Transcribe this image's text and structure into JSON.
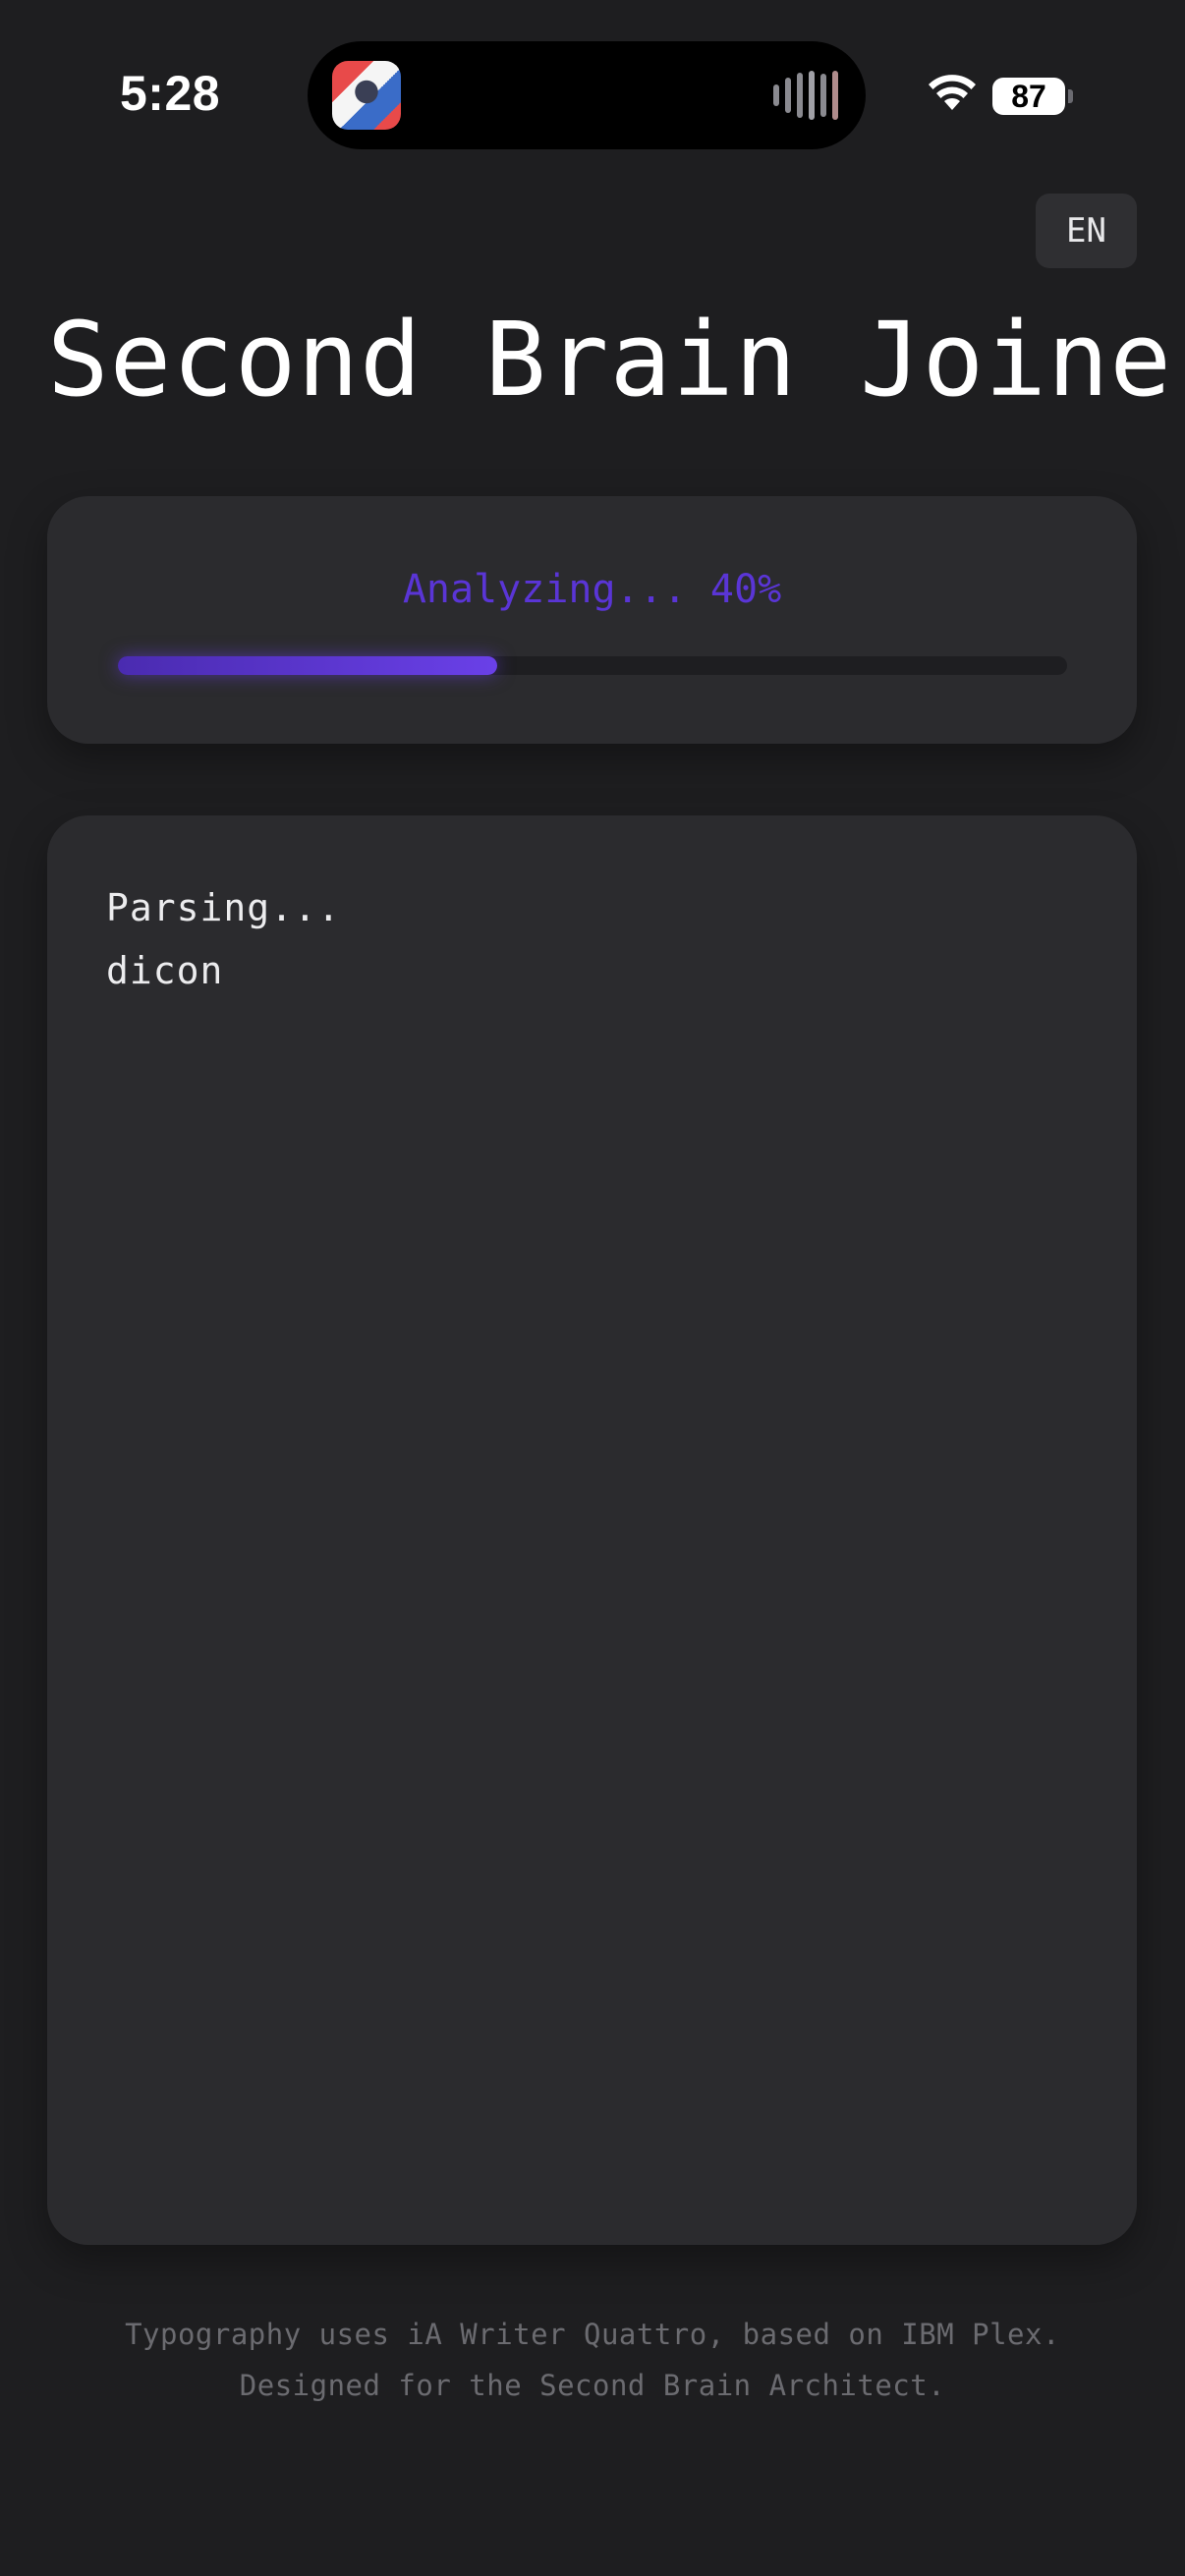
{
  "status_bar": {
    "time": "5:28",
    "battery": "87",
    "icons": [
      "now-playing-thumbnail-icon",
      "audio-waveform-icon",
      "wifi-icon",
      "battery-icon"
    ]
  },
  "header": {
    "language_button": "EN",
    "title": "Second Brain Joiner"
  },
  "progress": {
    "label": "Analyzing... 40%",
    "value": 0.4,
    "accent_color": "#5a35d6"
  },
  "log": {
    "lines": [
      "Parsing...",
      "dicon"
    ]
  },
  "footer": {
    "line1": "Typography uses iA Writer Quattro, based on IBM Plex.",
    "line2": "Designed for the Second Brain Architect."
  },
  "colors": {
    "background": "#1e1e20",
    "card": "#2b2b2e",
    "accent": "#5a35d6"
  }
}
